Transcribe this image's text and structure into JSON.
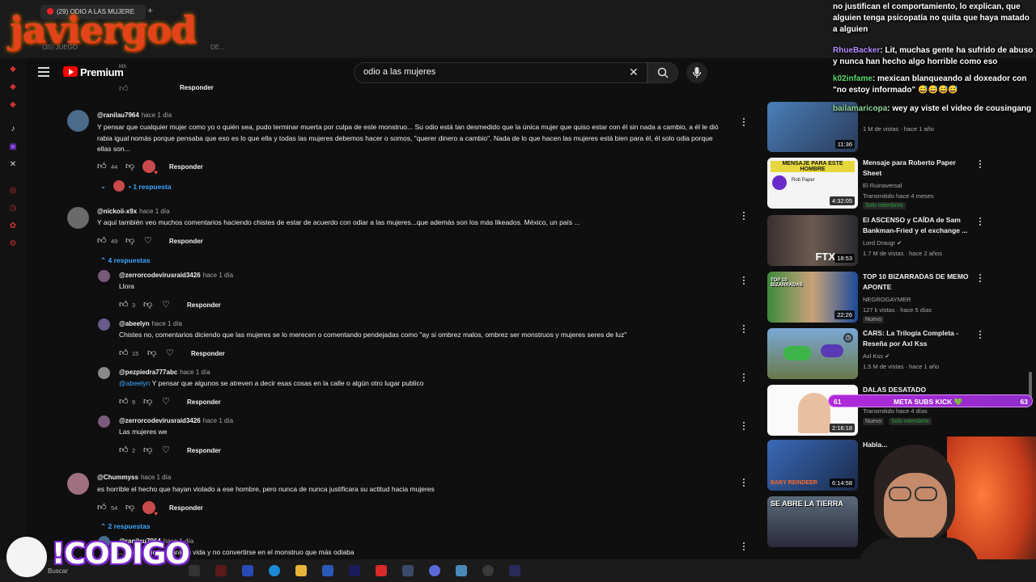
{
  "browser": {
    "tab_title": "(29) ODIO A LAS MUJERE",
    "overlay_logo": "javiergod",
    "ghost_text": "(35) JUEGO",
    "ghost_text2": "DE..."
  },
  "header": {
    "brand": "Premium",
    "region": "MX",
    "search_value": "odio a las mujeres"
  },
  "comments": [
    {
      "handle": "@ranilau7964",
      "time": "hace 1 día",
      "text": "Y pensar que cualquier mujer como yo o quién sea, pudo terminar muerta por culpa de este monstruo... Su odio está tan desmedido que la única mujer que quiso estar con él sin nada a cambio, a él le dió rabia igual nomás porque pensaba que eso es lo que ella y todas las mujeres debemos hacer o somos, \"querer dinero a cambio\". Nada de lo que hacen las mujeres está bien para él, él solo odia porque ellas son...",
      "likes": "44",
      "reply_label": "Responder",
      "replies_toggle": "1 respuesta"
    },
    {
      "handle": "@nickoii-x9x",
      "time": "hace 1 día",
      "text": "Y aquí también veo muchos comentarios haciendo chistes de estar de acuerdo con odiar a las mujeres...que además son los más likeados. México, un país ...",
      "likes": "49",
      "reply_label": "Responder",
      "replies_toggle": "4 respuestas"
    },
    {
      "handle": "@zerrorcodevirusraid3426",
      "time": "hace 1 día",
      "text": "Llora",
      "likes": "3",
      "reply_label": "Responder"
    },
    {
      "handle": "@abeelyn",
      "time": "hace 1 día",
      "text": "Chistes no, comentarios diciendo que las mujeres se lo merecen o comentando pendejadas como \"ay si ombrez malos, ombrez ser monstruos y mujeres seres de luz\"",
      "likes": "15",
      "reply_label": "Responder"
    },
    {
      "handle": "@pezpiedra777abc",
      "time": "hace 1 día",
      "mention": "@abeelyn",
      "text": "Y pensar que algunos se atreven a decir esas cosas en la calle o algún otro lugar publico",
      "likes": "9",
      "reply_label": "Responder"
    },
    {
      "handle": "@zerrorcodevirusraid3426",
      "time": "hace 1 día",
      "text": "Las mujeres we",
      "likes": "2",
      "reply_label": "Responder"
    },
    {
      "handle": "@Chummyss",
      "time": "hace 1 día",
      "text": "es horrible el hecho que hayan violado a ese hombre, pero nunca de nunca justificara su actitud hacia mujeres",
      "likes": "54",
      "reply_label": "Responder",
      "replies_toggle": "2 respuestas"
    },
    {
      "handle": "@ranilau7964",
      "time": "hace 1 día",
      "text": "...ar otro rumbo para su vida y no convertirse en el monstruo que más odiaba"
    }
  ],
  "top_partial_reply": "Responder",
  "sidebar": [
    {
      "title": "",
      "channel": "",
      "meta": "1 M de vistas · hace 1 año",
      "duration": "11:36"
    },
    {
      "title": "Mensaje para Roberto Paper Sheet",
      "channel": "El Ruinaversal",
      "meta": "Transmitido hace 4 meses",
      "duration": "4:32:05",
      "members": "Solo miembros",
      "thumb_text": "MENSAJE PARA ESTE HOMBRE",
      "thumb_sub": "Rob Paper"
    },
    {
      "title": "El ASCENSO y CAÍDA de Sam Bankman-Fried y el exchange ...",
      "channel": "Lord Draugr",
      "meta": "1.7 M de vistas · hace 2 años",
      "duration": "18:53",
      "thumb_text": "FTX"
    },
    {
      "title": "TOP 10 BIZARRADAS DE MEMO APONTE",
      "channel": "NEGROGAYMER",
      "meta": "127 k vistas · hace 5 días",
      "badge": "Nuevo",
      "duration": "22:26",
      "thumb_text": "TOP 10 BIZARRADAS"
    },
    {
      "title": "CARS: La Trilogía Completa - Reseña por Axl Kss",
      "channel": "Axl Kss",
      "meta": "1.5 M de vistas · hace 1 año",
      "duration": ""
    },
    {
      "title": "DALAS DESATADO",
      "channel": "",
      "meta": "Transmitido hace 4 días",
      "badge": "Nuevo",
      "members": "Solo miembros",
      "duration": "2:16:18"
    },
    {
      "title": "Habla...",
      "channel": "",
      "meta": "",
      "duration": "6:14:58",
      "thumb_text": "BABY REINDEER"
    },
    {
      "title": "",
      "channel": "",
      "meta": "",
      "duration": "",
      "thumb_text": "SE ABRE LA TIERRA"
    }
  ],
  "chat": [
    {
      "user": "",
      "text": "no justifican el comportamiento, lo explican, que alguien tenga psicopatía no quita que haya matado a alguien"
    },
    {
      "user": "RhueBacker",
      "text": ": Lit, muchas gente ha sufrido de abuso y nunca han hecho algo horrible como eso"
    },
    {
      "user": "k02infame",
      "text": ": mexican blanqueando al doxeador con \"no estoy informado\" 😅😅😅😅"
    },
    {
      "user": "bailamaricopa",
      "text": ": wey ay viste el video de cousingang"
    }
  ],
  "subs_bar": {
    "left": "61",
    "label": "META SUBS KICK 💚",
    "right": "63"
  },
  "taskbar": {
    "search": "Buscar"
  },
  "overlay_bottom": "!CODIGO"
}
